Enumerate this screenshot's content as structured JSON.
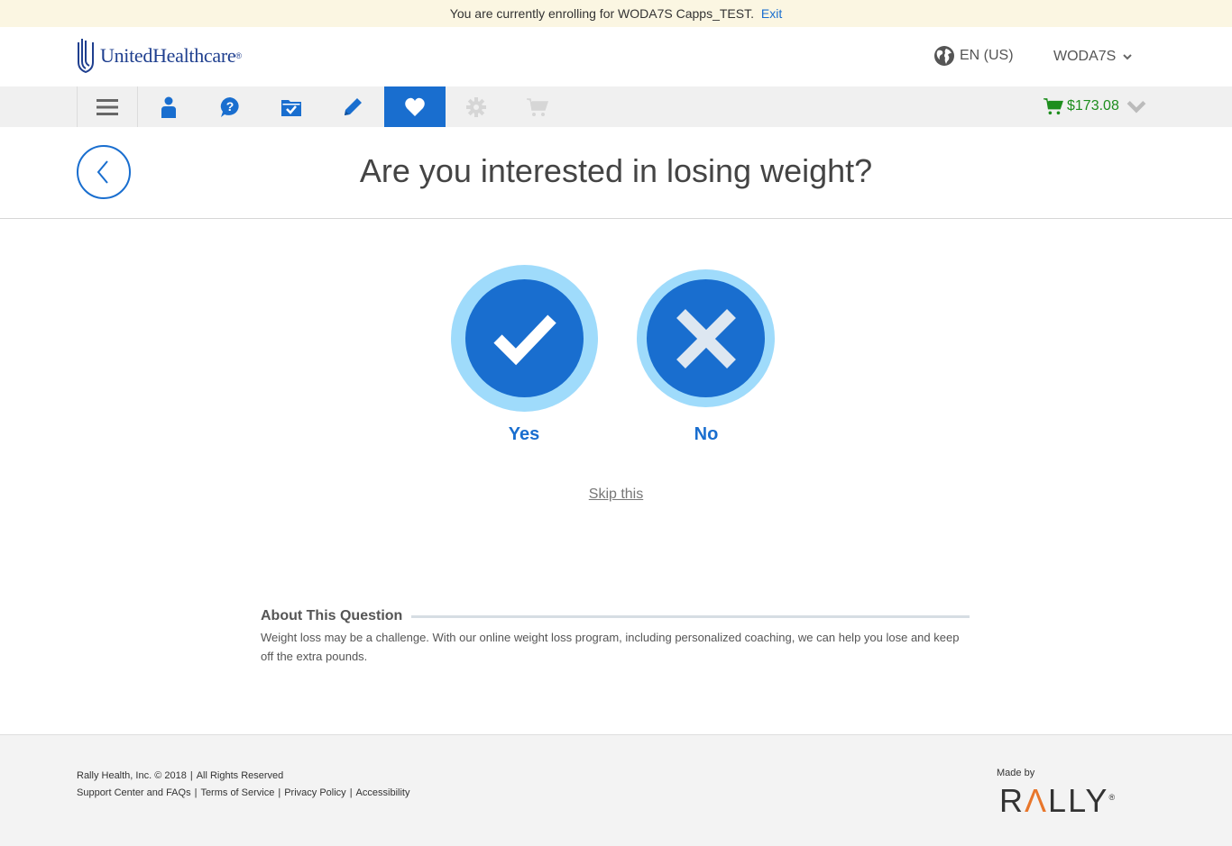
{
  "banner": {
    "text": "You are currently enrolling for WODA7S Capps_TEST.",
    "exit_label": "Exit"
  },
  "header": {
    "brand": "UnitedHealthcare",
    "brand_reg": "®",
    "language": "EN (US)",
    "user": "WODA7S"
  },
  "nav": {
    "items": [
      {
        "icon": "menu-icon",
        "active": false,
        "enabled": true
      },
      {
        "icon": "person-icon",
        "active": false,
        "enabled": true
      },
      {
        "icon": "question-icon",
        "active": false,
        "enabled": true
      },
      {
        "icon": "folder-check-icon",
        "active": false,
        "enabled": true
      },
      {
        "icon": "pencil-icon",
        "active": false,
        "enabled": true
      },
      {
        "icon": "heart-icon",
        "active": true,
        "enabled": true
      },
      {
        "icon": "gear-icon",
        "active": false,
        "enabled": false
      },
      {
        "icon": "cart-icon",
        "active": false,
        "enabled": false
      }
    ],
    "cart_total": "$173.08"
  },
  "question": {
    "title": "Are you interested in losing weight?",
    "yes_label": "Yes",
    "no_label": "No",
    "skip_label": "Skip this"
  },
  "about": {
    "title": "About This Question",
    "text": "Weight loss may be a challenge. With our online weight loss program, including personalized coaching, we can help you lose and keep off the extra pounds."
  },
  "footer": {
    "copyright": "Rally Health, Inc. © 2018",
    "rights": "All Rights Reserved",
    "links": [
      "Support Center and FAQs",
      "Terms of Service",
      "Privacy Policy",
      "Accessibility"
    ],
    "made_by": "Made by",
    "rally_brand": "RALLY"
  },
  "colors": {
    "primary": "#196ecf",
    "light_ring": "#9fdbfb",
    "banner_bg": "#fbf6e2",
    "price_green": "#1e8e1e",
    "rally_orange": "#e8762b"
  }
}
